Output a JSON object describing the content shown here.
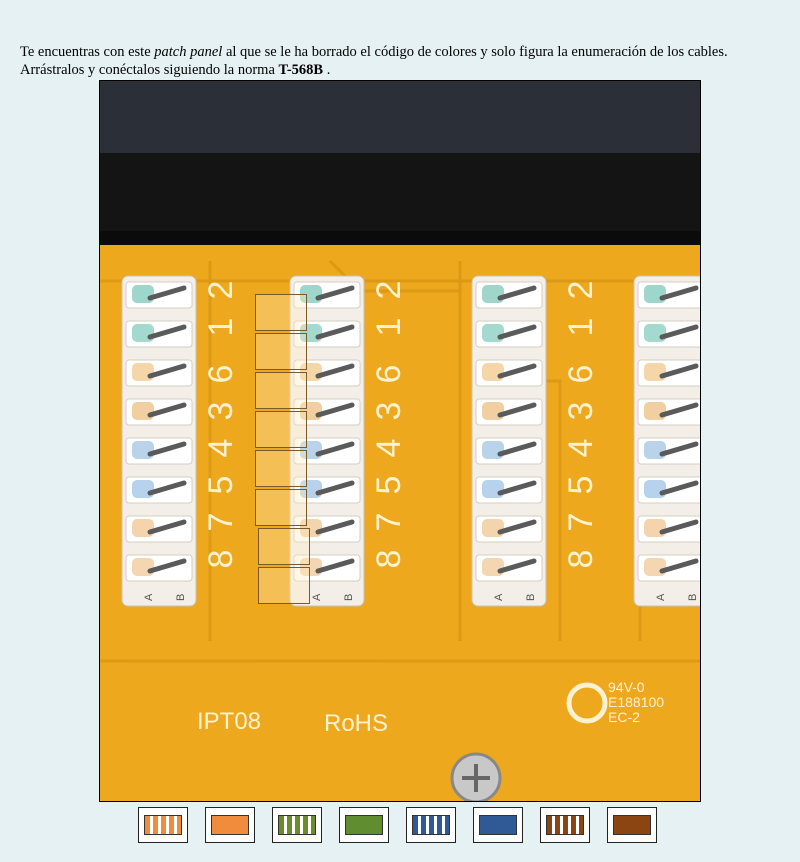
{
  "instructions": {
    "part1": "Te encuentras con este ",
    "part2_italic": "patch panel",
    "part3": " al que se le ha borrado el código de colores y solo figura la enumeración de los cables. Arrástralos y conéctalos siguiendo la norma ",
    "part4_bold": "T-568B",
    "part5": " ."
  },
  "board": {
    "silkscreen_left": "IPT08",
    "silkscreen_mid": "RoHS",
    "cert_lines": [
      "94V-0",
      "E188100",
      "EC-2"
    ],
    "pin_numbers": [
      "8",
      "7",
      "5",
      "4",
      "3",
      "6",
      "1",
      "2"
    ],
    "ab_labels": [
      "A",
      "B"
    ]
  },
  "drop_slots": [
    {
      "position": 1
    },
    {
      "position": 2
    },
    {
      "position": 3
    },
    {
      "position": 4
    },
    {
      "position": 5
    },
    {
      "position": 6
    },
    {
      "position": 7
    },
    {
      "position": 8
    }
  ],
  "cables": [
    {
      "name": "white-orange",
      "color": "#f08c3c",
      "style": "striped"
    },
    {
      "name": "orange",
      "color": "#f08c3c",
      "style": "solid"
    },
    {
      "name": "white-green",
      "color": "#6a8d2a",
      "style": "striped"
    },
    {
      "name": "green",
      "color": "#5f8d30",
      "style": "solid"
    },
    {
      "name": "white-blue",
      "color": "#2f5a95",
      "style": "striped"
    },
    {
      "name": "blue",
      "color": "#2f5a95",
      "style": "solid"
    },
    {
      "name": "white-brown",
      "color": "#8a4512",
      "style": "striped"
    },
    {
      "name": "brown",
      "color": "#8a4512",
      "style": "solid"
    }
  ]
}
